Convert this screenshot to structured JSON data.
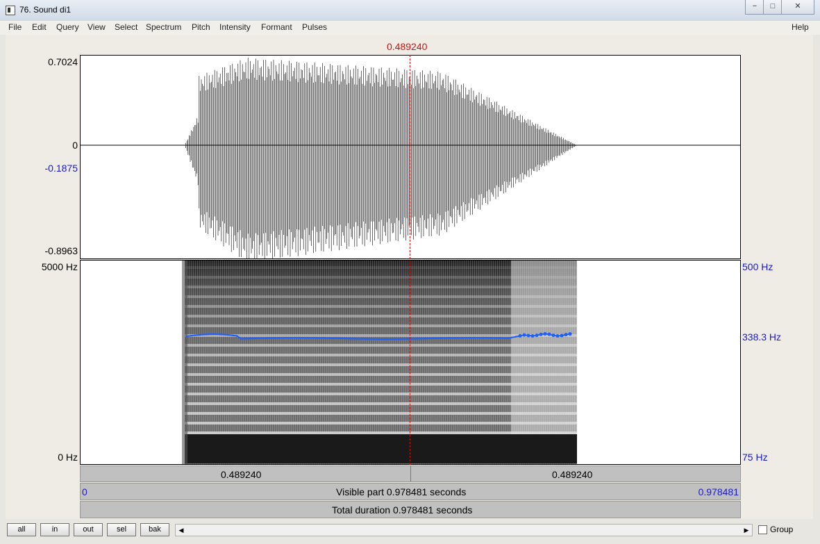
{
  "window": {
    "title": "76. Sound di1",
    "minimize": "−",
    "maximize": "□",
    "close": "✕"
  },
  "menu": {
    "items": [
      "File",
      "Edit",
      "Query",
      "View",
      "Select",
      "Spectrum",
      "Pitch",
      "Intensity",
      "Formant",
      "Pulses"
    ],
    "help": "Help"
  },
  "cursor_time": "0.489240",
  "waveform": {
    "max_label": "0.7024",
    "zero_label": "0",
    "cursor_value": "-0.1875",
    "min_label": "-0.8963"
  },
  "spectrogram": {
    "top_freq": "5000 Hz",
    "bottom_freq": "0 Hz"
  },
  "pitch": {
    "top": "500 Hz",
    "current": "338.3 Hz",
    "bottom": "75 Hz",
    "line_color": "#1f5fff"
  },
  "time_bar": {
    "left": "0.489240",
    "right": "0.489240"
  },
  "visible_bar": {
    "start": "0",
    "label": "Visible part 0.978481 seconds",
    "end": "0.978481"
  },
  "total_bar": {
    "label": "Total duration 0.978481 seconds"
  },
  "buttons": {
    "all": "all",
    "in": "in",
    "out": "out",
    "sel": "sel",
    "bak": "bak"
  },
  "scrollbar": {
    "left_arrow": "◀",
    "right_arrow": "▶"
  },
  "group_label": "Group",
  "colors": {
    "cursor": "#cc1111",
    "axis_blue": "#1a1ac8"
  }
}
